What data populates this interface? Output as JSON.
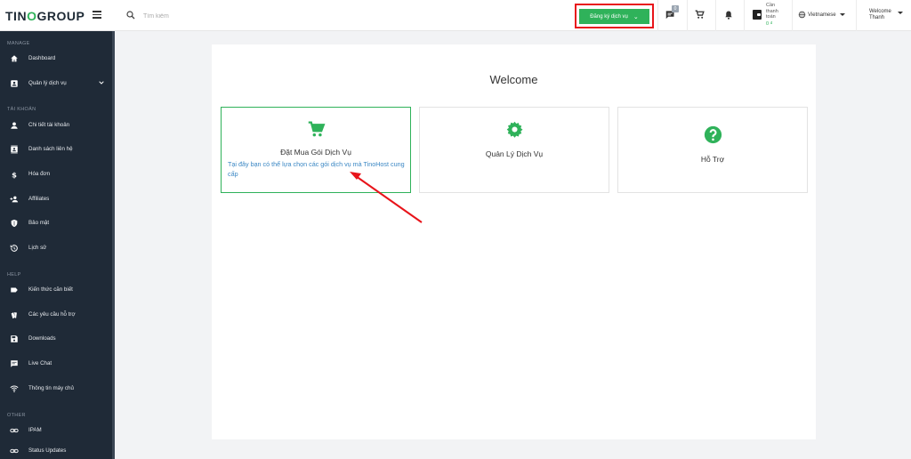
{
  "header": {
    "logo_part1": "TIN",
    "logo_part2": "O",
    "logo_part3": "GROUP",
    "search_placeholder": "Tìm kiếm",
    "register_label": "Đăng ký dịch vụ",
    "chat_badge": "0",
    "balance_label": "Cần thanh toán",
    "balance_amount": "0 ₫",
    "language": "Vietnamese",
    "welcome_line1": "Welcome",
    "welcome_line2": "Thanh",
    "accent_color": "#2fb25a",
    "highlight_color": "#e8141a"
  },
  "sidebar": {
    "sections": {
      "manage": "MANAGE",
      "account": "TÀI KHOẢN",
      "help": "HELP",
      "other": "OTHER"
    },
    "items": [
      {
        "label": "Dashboard",
        "icon": "home-icon"
      },
      {
        "label": "Quản lý dịch vụ",
        "icon": "account-box-icon"
      },
      {
        "label": "Chi tiết tài khoản",
        "icon": "person-icon"
      },
      {
        "label": "Danh sách liên hệ",
        "icon": "contacts-icon"
      },
      {
        "label": "Hóa đơn",
        "icon": "dollar-icon"
      },
      {
        "label": "Affiliates",
        "icon": "person-add-icon"
      },
      {
        "label": "Bảo mật",
        "icon": "shield-icon"
      },
      {
        "label": "Lịch sử",
        "icon": "history-icon"
      },
      {
        "label": "Kiến thức căn biết",
        "icon": "label-icon"
      },
      {
        "label": "Các yêu cầu hỗ trợ",
        "icon": "tickets-icon"
      },
      {
        "label": "Downloads",
        "icon": "save-icon"
      },
      {
        "label": "Live Chat",
        "icon": "chat-icon"
      },
      {
        "label": "Thông tin máy chủ",
        "icon": "wifi-icon"
      },
      {
        "label": "IPAM",
        "icon": "link-icon"
      },
      {
        "label": "Status Updates",
        "icon": "link-icon"
      }
    ]
  },
  "main": {
    "welcome_title": "Welcome",
    "cards": [
      {
        "title": "Đặt Mua Gói Dịch Vụ",
        "description": "Tại đây bạn có thể lựa chọn các gói dịch vụ mà TinoHost cung cấp",
        "icon": "cart-icon"
      },
      {
        "title": "Quản Lý Dịch Vụ",
        "icon": "gear-icon"
      },
      {
        "title": "Hỗ Trợ",
        "icon": "help-icon"
      }
    ]
  }
}
